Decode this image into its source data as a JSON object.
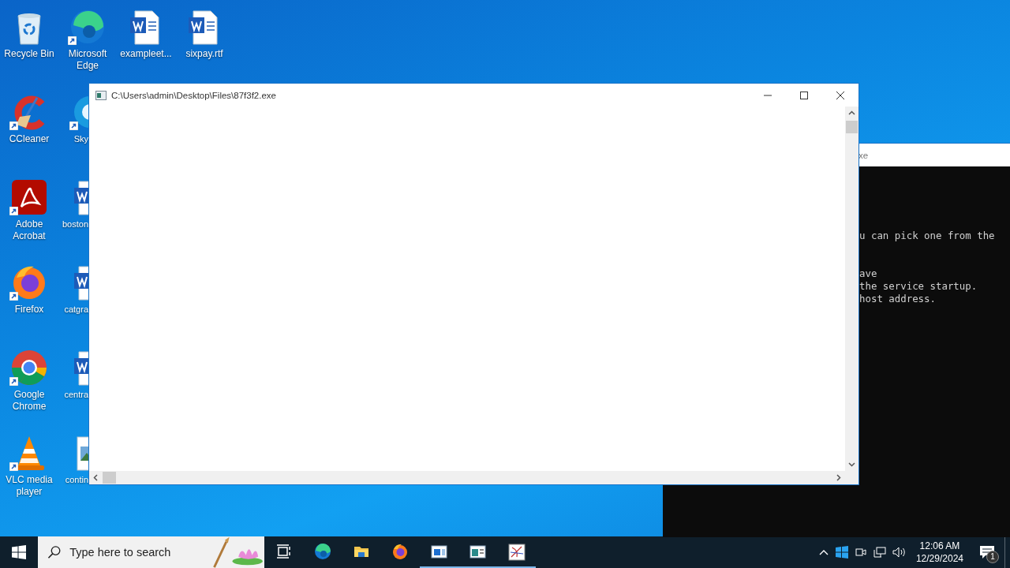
{
  "desktop": {
    "columns": [
      [
        {
          "label": "Recycle Bin",
          "kind": "trash",
          "shortcut": false,
          "covered": false
        },
        {
          "label": "CCleaner",
          "kind": "cleaner",
          "shortcut": true,
          "covered": false
        },
        {
          "label": "Adobe Acrobat",
          "kind": "pdf",
          "shortcut": true,
          "covered": false
        },
        {
          "label": "Firefox",
          "kind": "firefox",
          "shortcut": true,
          "covered": false
        },
        {
          "label": "Google Chrome",
          "kind": "chrome",
          "shortcut": true,
          "covered": false
        },
        {
          "label": "VLC media player",
          "kind": "cone",
          "shortcut": true,
          "covered": false
        }
      ],
      [
        {
          "label": "Microsoft Edge",
          "kind": "edge",
          "shortcut": true,
          "covered": false
        },
        {
          "label": "Sky",
          "kind": "skype",
          "shortcut": true,
          "covered": true
        },
        {
          "label": "boston",
          "kind": "document",
          "shortcut": false,
          "covered": true
        },
        {
          "label": "catgra",
          "kind": "document",
          "shortcut": false,
          "covered": true
        },
        {
          "label": "centra",
          "kind": "document",
          "shortcut": false,
          "covered": true
        },
        {
          "label": "contin",
          "kind": "image",
          "shortcut": false,
          "covered": true
        }
      ],
      [
        {
          "label": "exampleet...",
          "kind": "document",
          "shortcut": false,
          "covered": false
        }
      ],
      [
        {
          "label": "sixpay.rtf",
          "kind": "document",
          "shortcut": false,
          "covered": false
        }
      ]
    ]
  },
  "window": {
    "title": "C:\\Users\\admin\\Desktop\\Files\\87f3f2.exe"
  },
  "console": {
    "title": "xe",
    "paragraphs": [
      [
        "u can pick one from the"
      ],
      [
        "ave",
        "the service startup.",
        "host address."
      ]
    ]
  },
  "taskbar": {
    "search": {
      "placeholder": "Type here to search"
    },
    "apps": [
      {
        "kind": "task-view",
        "running": false
      },
      {
        "kind": "edge",
        "running": false
      },
      {
        "kind": "folder",
        "running": false
      },
      {
        "kind": "firefox",
        "running": false
      },
      {
        "kind": "window-blue",
        "running": true
      },
      {
        "kind": "window-green",
        "running": true
      },
      {
        "kind": "drawing-app",
        "running": true
      }
    ],
    "clock": {
      "time": "12:06 AM",
      "date": "12/29/2024"
    },
    "notifications": {
      "badge": "1"
    }
  }
}
